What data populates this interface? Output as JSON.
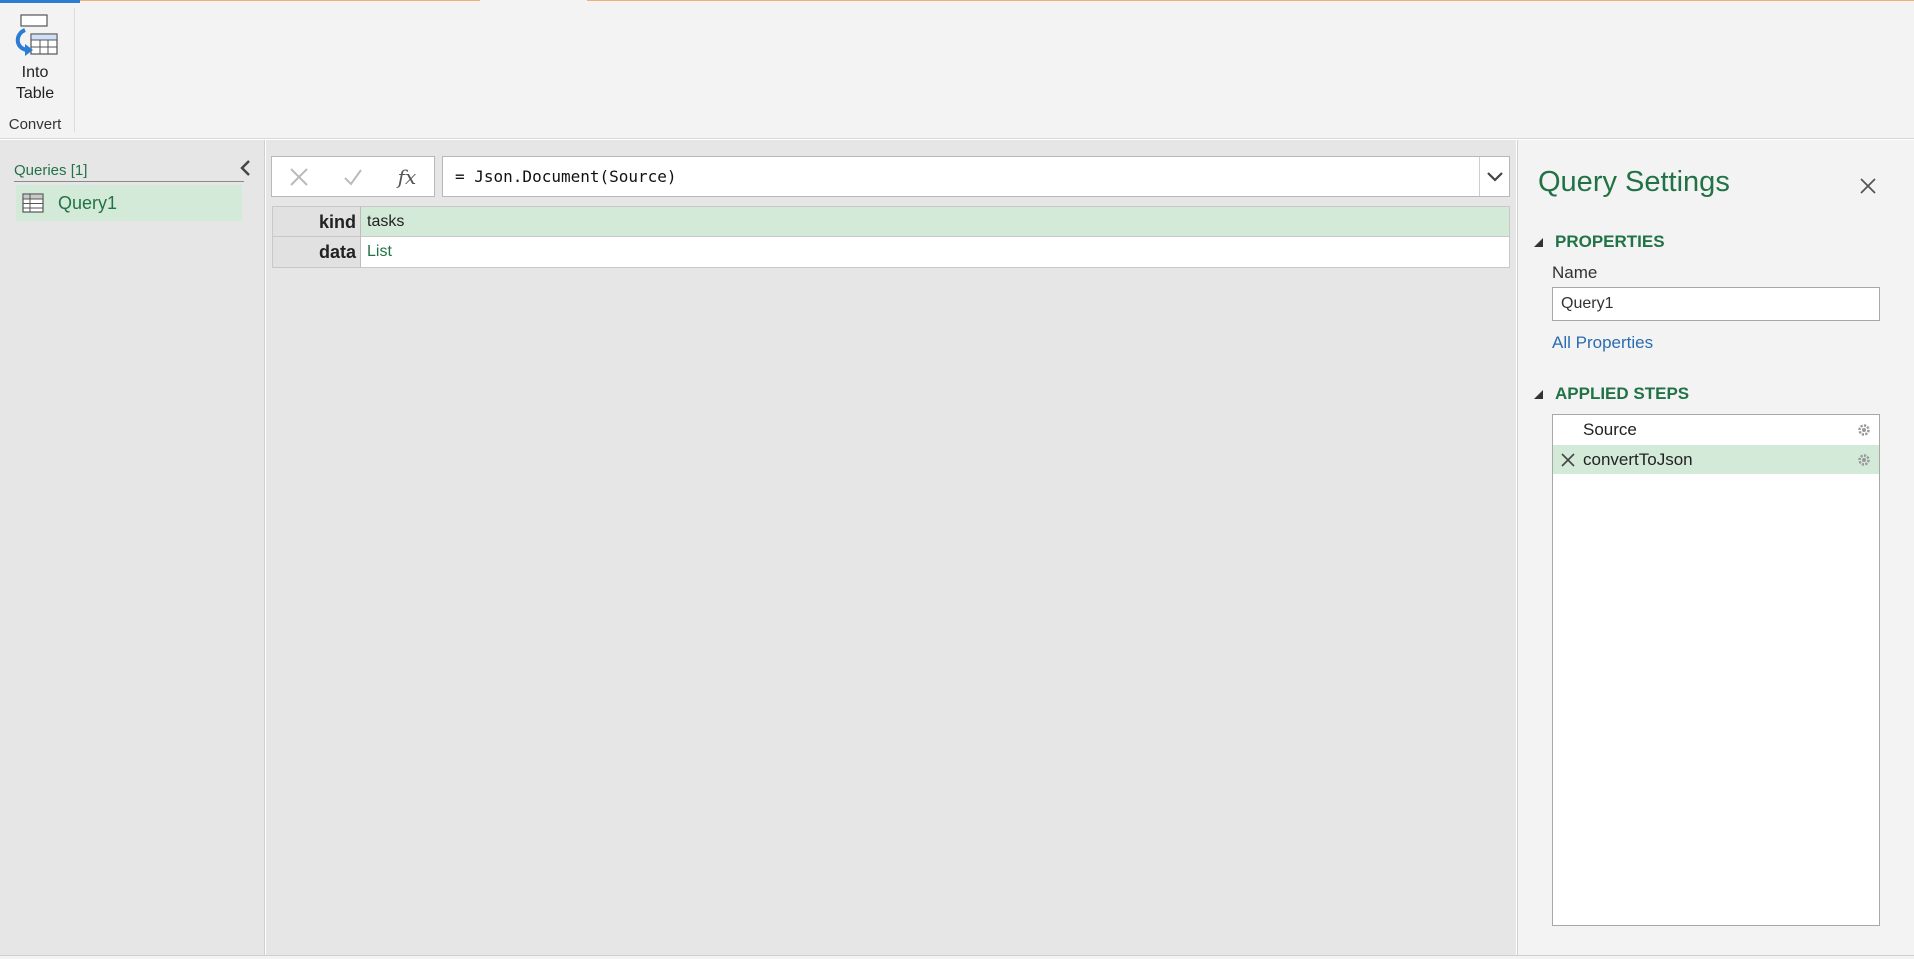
{
  "ribbon": {
    "into_table_label_line1": "Into",
    "into_table_label_line2": "Table",
    "group_label": "Convert"
  },
  "queries": {
    "header": "Queries [1]",
    "items": [
      {
        "label": "Query1"
      }
    ]
  },
  "formula": {
    "text": "= Json.Document(Source)"
  },
  "record": {
    "rows": [
      {
        "key": "kind",
        "value": "tasks"
      },
      {
        "key": "data",
        "value": "List"
      }
    ]
  },
  "settings": {
    "title": "Query Settings",
    "properties_header": "PROPERTIES",
    "name_label": "Name",
    "name_value": "Query1",
    "all_properties_link": "All Properties",
    "applied_steps_header": "APPLIED STEPS",
    "steps": [
      {
        "label": "Source"
      },
      {
        "label": "convertToJson"
      }
    ]
  },
  "colors": {
    "accent_green": "#217346",
    "selection_green": "#d4ead9",
    "link_blue": "#2b6cb0"
  }
}
